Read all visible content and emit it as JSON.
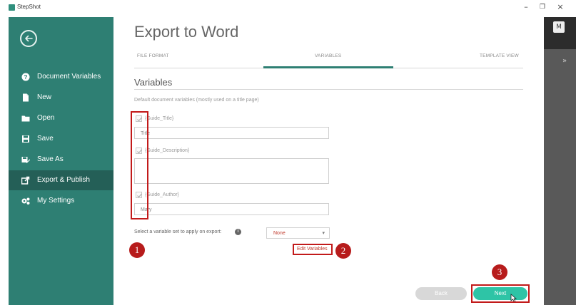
{
  "titlebar": {
    "app_name": "StepShot",
    "minimize": "–",
    "restore": "❐",
    "close": "×"
  },
  "sidebar": {
    "back_icon": "arrow-left-circle-icon",
    "items": [
      {
        "label": "Document Variables",
        "icon": "question-icon",
        "active": false
      },
      {
        "label": "New",
        "icon": "document-icon",
        "active": false
      },
      {
        "label": "Open",
        "icon": "folder-icon",
        "active": false
      },
      {
        "label": "Save",
        "icon": "floppy-icon",
        "active": false
      },
      {
        "label": "Save As",
        "icon": "floppy-pen-icon",
        "active": false
      },
      {
        "label": "Export & Publish",
        "icon": "export-icon",
        "active": true
      },
      {
        "label": "My Settings",
        "icon": "gears-icon",
        "active": false
      }
    ]
  },
  "main": {
    "title": "Export to Word",
    "steps": [
      "FILE FORMAT",
      "VARIABLES",
      "TEMPLATE VIEW"
    ],
    "active_step": "VARIABLES",
    "section_title": "Variables",
    "hint": "Default document variables (mostly used on a title page)",
    "variables": [
      {
        "name": "{Guide_Title}",
        "value": "Title",
        "checked": true
      },
      {
        "name": "{Guide_Description}",
        "value": "",
        "checked": true
      },
      {
        "name": "{Guide_Author}",
        "value": "Mary",
        "checked": true
      }
    ],
    "set_label": "Select a variable set to apply on export:",
    "set_value": "None",
    "edit_link": "Edit Variables",
    "back_button": "Back",
    "next_button": "Next"
  },
  "callouts": [
    "1",
    "2",
    "3"
  ],
  "user": {
    "initial": "M"
  },
  "colors": {
    "sidebar": "#2e7f73",
    "sidebar_active": "#245f57",
    "accent_button": "#2ec4a6",
    "callout": "#b71c1c",
    "link": "#c0392b"
  }
}
